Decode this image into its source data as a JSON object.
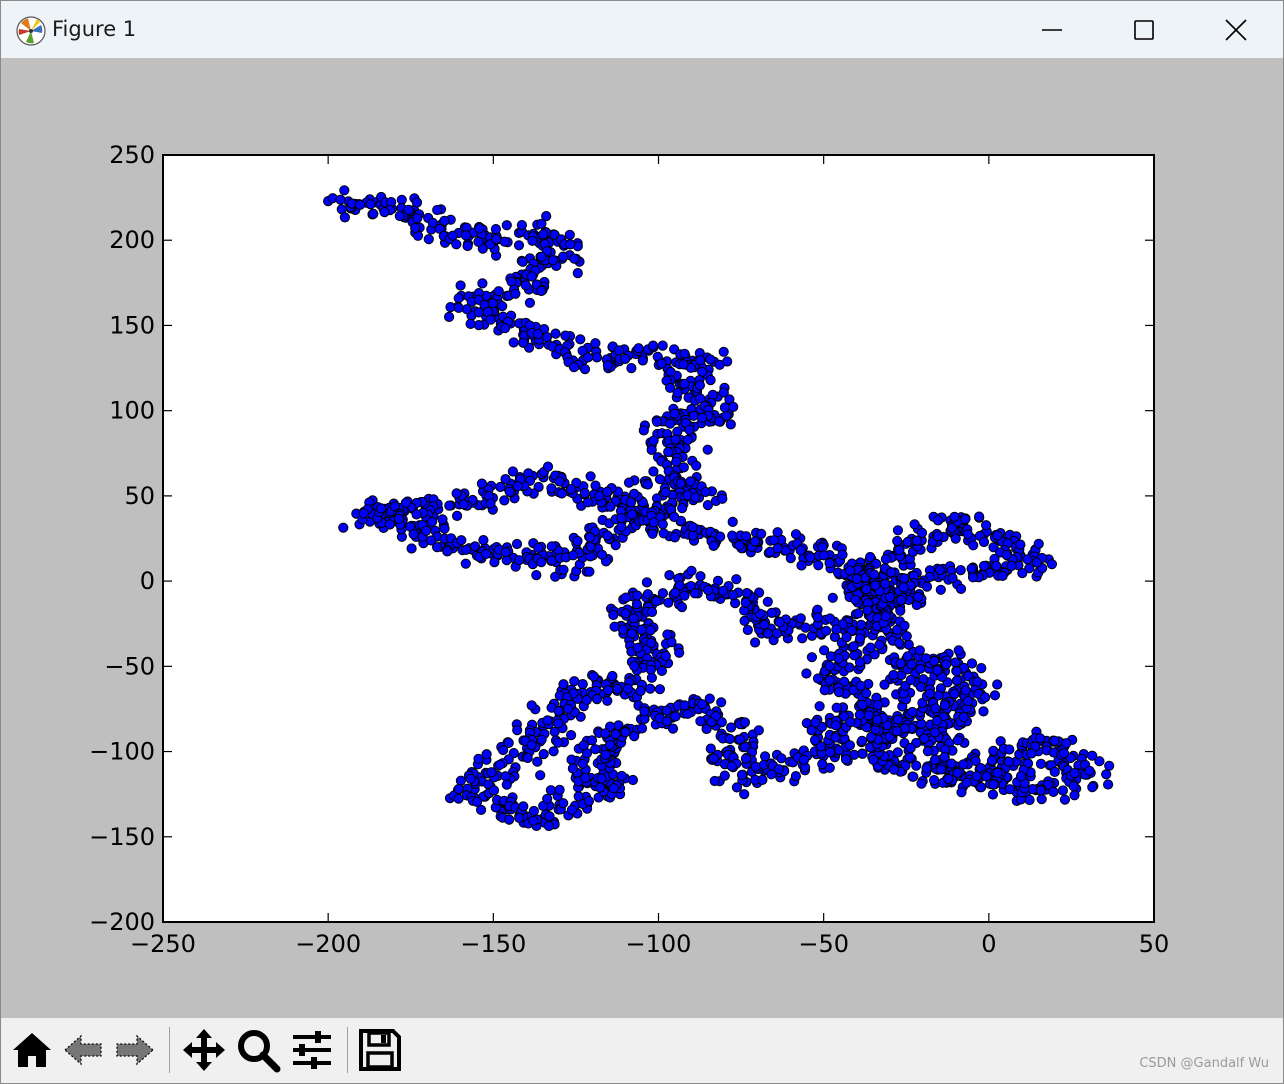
{
  "window": {
    "title": "Figure 1",
    "app_icon": "matplotlib-logo-icon",
    "controls": [
      "minimize-icon",
      "maximize-icon",
      "close-icon"
    ]
  },
  "toolbar": {
    "buttons": [
      {
        "name": "home-button",
        "icon": "home-icon"
      },
      {
        "name": "back-button",
        "icon": "arrow-left-icon"
      },
      {
        "name": "forward-button",
        "icon": "arrow-right-icon"
      },
      {
        "name": "pan-button",
        "icon": "move-arrows-icon"
      },
      {
        "name": "zoom-button",
        "icon": "magnifier-icon"
      },
      {
        "name": "configure-subplots-button",
        "icon": "sliders-icon"
      },
      {
        "name": "save-button",
        "icon": "floppy-disk-icon"
      }
    ]
  },
  "watermark": "CSDN @Gandalf Wu",
  "colors": {
    "figure_bg": "#bfbfbf",
    "axes_bg": "#ffffff",
    "marker_fill": "#0000ff",
    "marker_edge": "#000000",
    "titlebar_bg": "#eef3f8",
    "toolbar_bg": "#f0f0f0"
  },
  "chart_data": {
    "type": "scatter",
    "title": "",
    "xlabel": "",
    "ylabel": "",
    "xlim": [
      -250,
      50
    ],
    "ylim": [
      -200,
      250
    ],
    "xticks": [
      -250,
      -200,
      -150,
      -100,
      -50,
      0,
      50
    ],
    "yticks": [
      -200,
      -150,
      -100,
      -50,
      0,
      50,
      100,
      150,
      200,
      250
    ],
    "xtick_labels": [
      "−250",
      "−200",
      "−150",
      "−100",
      "−50",
      "0",
      "50"
    ],
    "ytick_labels": [
      "−200",
      "−150",
      "−100",
      "−50",
      "0",
      "50",
      "100",
      "150",
      "200",
      "250"
    ],
    "grid": false,
    "legend": "none",
    "description_of_series": "random walk",
    "path_waypoints": [
      [
        -198,
        220
      ],
      [
        -180,
        220
      ],
      [
        -160,
        200
      ],
      [
        -138,
        205
      ],
      [
        -128,
        195
      ],
      [
        -138,
        175
      ],
      [
        -158,
        160
      ],
      [
        -142,
        150
      ],
      [
        -132,
        138
      ],
      [
        -120,
        130
      ],
      [
        -110,
        132
      ],
      [
        -98,
        130
      ],
      [
        -86,
        128
      ],
      [
        -92,
        110
      ],
      [
        -80,
        100
      ],
      [
        -100,
        90
      ],
      [
        -92,
        70
      ],
      [
        -100,
        55
      ],
      [
        -86,
        52
      ],
      [
        -100,
        40
      ],
      [
        -120,
        50
      ],
      [
        -135,
        60
      ],
      [
        -150,
        50
      ],
      [
        -165,
        45
      ],
      [
        -190,
        40
      ],
      [
        -168,
        30
      ],
      [
        -160,
        18
      ],
      [
        -140,
        15
      ],
      [
        -125,
        10
      ],
      [
        -118,
        25
      ],
      [
        -108,
        40
      ],
      [
        -95,
        30
      ],
      [
        -82,
        25
      ],
      [
        -75,
        22
      ],
      [
        -60,
        20
      ],
      [
        -48,
        15
      ],
      [
        -38,
        8
      ],
      [
        -42,
        -2
      ],
      [
        -35,
        -10
      ],
      [
        -28,
        15
      ],
      [
        -20,
        28
      ],
      [
        -10,
        35
      ],
      [
        0,
        28
      ],
      [
        8,
        18
      ],
      [
        14,
        12
      ],
      [
        -5,
        5
      ],
      [
        -20,
        0
      ],
      [
        -30,
        -15
      ],
      [
        -42,
        -28
      ],
      [
        -55,
        -25
      ],
      [
        -65,
        -30
      ],
      [
        -70,
        -15
      ],
      [
        -82,
        -5
      ],
      [
        -90,
        0
      ],
      [
        -98,
        -10
      ],
      [
        -110,
        -15
      ],
      [
        -108,
        -30
      ],
      [
        -100,
        -35
      ],
      [
        -105,
        -55
      ],
      [
        -110,
        -65
      ],
      [
        -120,
        -60
      ],
      [
        -128,
        -72
      ],
      [
        -135,
        -90
      ],
      [
        -142,
        -100
      ],
      [
        -150,
        -112
      ],
      [
        -158,
        -122
      ],
      [
        -145,
        -135
      ],
      [
        -135,
        -140
      ],
      [
        -128,
        -128
      ],
      [
        -120,
        -120
      ],
      [
        -112,
        -122
      ],
      [
        -122,
        -105
      ],
      [
        -112,
        -90
      ],
      [
        -102,
        -80
      ],
      [
        -90,
        -72
      ],
      [
        -80,
        -82
      ],
      [
        -75,
        -95
      ],
      [
        -80,
        -108
      ],
      [
        -70,
        -115
      ],
      [
        -58,
        -105
      ],
      [
        -45,
        -100
      ],
      [
        -50,
        -85
      ],
      [
        -35,
        -80
      ],
      [
        -28,
        -90
      ],
      [
        -22,
        -80
      ],
      [
        -18,
        -65
      ],
      [
        -25,
        -50
      ],
      [
        -15,
        -42
      ],
      [
        -8,
        -55
      ],
      [
        -5,
        -65
      ],
      [
        -10,
        -78
      ],
      [
        -15,
        -92
      ],
      [
        -20,
        -105
      ],
      [
        -10,
        -112
      ],
      [
        0,
        -108
      ],
      [
        10,
        -100
      ],
      [
        18,
        -92
      ],
      [
        25,
        -105
      ],
      [
        30,
        -112
      ],
      [
        20,
        -120
      ],
      [
        10,
        -125
      ],
      [
        5,
        -112
      ],
      [
        -5,
        -118
      ],
      [
        -15,
        -112
      ],
      [
        -28,
        -108
      ],
      [
        -38,
        -100
      ],
      [
        -30,
        -85
      ],
      [
        -40,
        -70
      ],
      [
        -50,
        -55
      ],
      [
        -40,
        -42
      ],
      [
        -30,
        -30
      ],
      [
        -35,
        -15
      ],
      [
        -25,
        -5
      ],
      [
        -40,
        2
      ]
    ]
  }
}
